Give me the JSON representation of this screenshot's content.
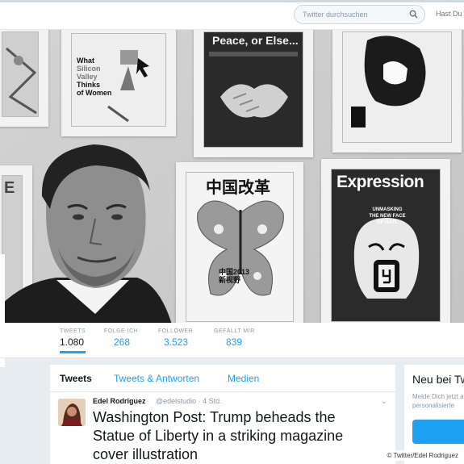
{
  "search": {
    "placeholder": "Twitter durchsuchen",
    "icon": "search-icon"
  },
  "header_right_text": "Hast Du",
  "header_photo": {
    "covers": {
      "silicon_valley": [
        "What",
        "Silicon",
        "Valley",
        "Thinks",
        "of Women"
      ],
      "peace_title": "Peace, or Else...",
      "expression_title": "Expression",
      "expression_caption": "UNMASKING THE NEW FACE OF HATE",
      "china_title": "中国改革",
      "china_subtitle": [
        "中国2013",
        "新视野"
      ]
    }
  },
  "stats": [
    {
      "label": "TWEETS",
      "value": "1.080"
    },
    {
      "label": "FOLGE ICH",
      "value": "268"
    },
    {
      "label": "FOLLOWER",
      "value": "3.523"
    },
    {
      "label": "GEFÄLLT MIR",
      "value": "839"
    }
  ],
  "tabs": [
    {
      "label": "Tweets"
    },
    {
      "label": "Tweets & Antworten"
    },
    {
      "label": "Medien"
    }
  ],
  "tweet": {
    "name": "Edel Rodriguez",
    "meta": "@edelstudio · 4 Std.",
    "text": "Washington Post: Trump beheads the Statue of Liberty in a striking magazine cover illustration"
  },
  "sidebar": {
    "title": "Neu bei Twitter?",
    "description": [
      "Melde Dich jetzt an und",
      "personalisierte"
    ]
  },
  "credit": "© Twitter/Edel Rodriguez",
  "colors": {
    "accent": "#1da1f2",
    "background": "#e6ecf0"
  }
}
